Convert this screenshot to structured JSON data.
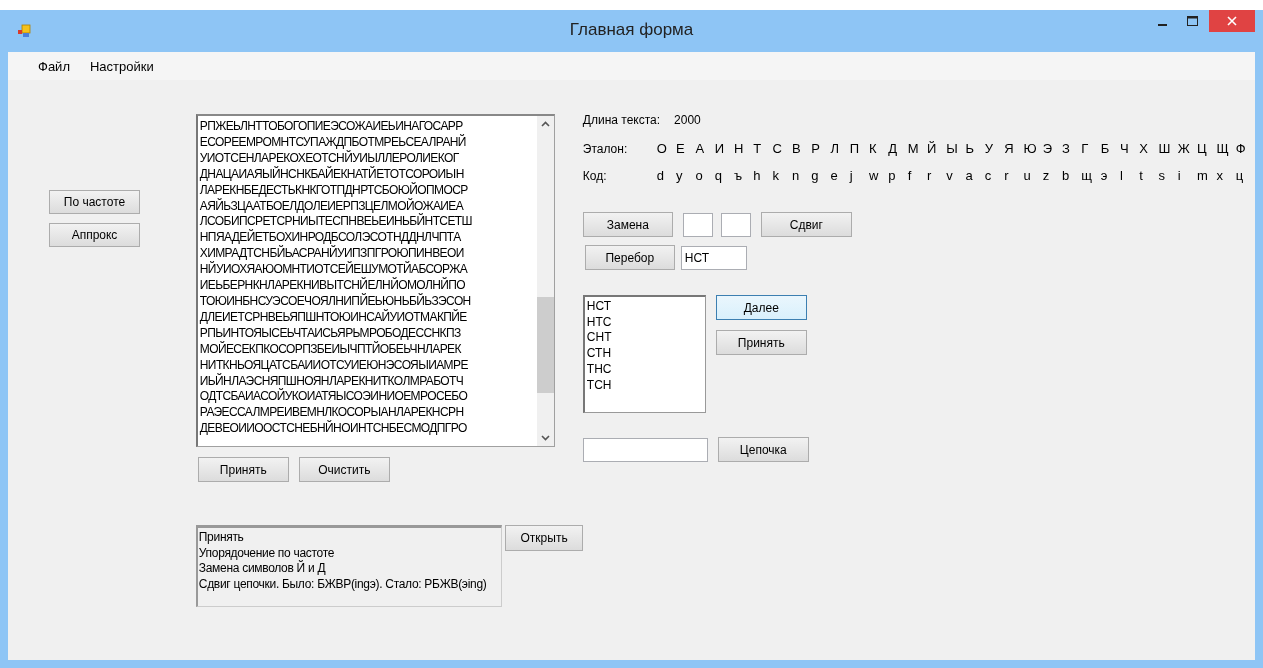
{
  "window": {
    "title": "Главная форма"
  },
  "menu": [
    {
      "label": "Файл"
    },
    {
      "label": "Настройки"
    }
  ],
  "left_buttons": [
    "По частоте",
    "Аппрокс"
  ],
  "text_lines": [
    "РПЖЕЬЛНТТОБОГОПИЕЭСОЖАИЕЬИНАГОСАРР",
    "ЕСОРЕЕМРОМНТСУПАЖДПБОТМРЕЬСЕАЛРАНЙ",
    "УИОТСЕНЛАРЕКОХЕОТСНЙУИЫЛЛЕРОЛИЕКОГ",
    "ДНАЦАИАЯЫЙНСНКБАЙЕКНАТЙЕТОТСОРОИЫН",
    "ЛАРЕКНБЕДЕСТЬКНКГОТПДНРТСБОЮЙОПМОСР",
    "АЯЙЬЗЦААТБОЕЛДОЛЕИЕРПЗЦЕЛМОЙОЖАИЕА",
    "ЛСОБИПСРЕТСРНИЫТЕСПНВЕЬЕИНЬБЙНТСЕТШ",
    "НПЯАДЕЙЕТБОХИНРОДБСОЛЭСОТНДДНЛЧПТА",
    "ХИМРАДТСНБЙЬАСРАНЙУИПЗПГРОЮПИНВЕОИ",
    "НЙУИОХЯАЮОМНТИОТСЕЙЕШУМОТЙАБСОРЖА",
    "ИЕЬБЕРНКНЛАРЕКНИВЫТСНЙЕЛНЙОМОЛНЙПО",
    "ТОЮИНБНСУЭСОЕЧОЯЛНИПЙЕЬЮНЬБЙЬЗЭСОН",
    "ДЛЕИЕТСРНВЕЬЯПШНТОЮИНСАЙУИОТМАКПЙЕ",
    "РПЬИНТОЯЫСЕЬЧТАИСЬЯРЬМРОБОДЕССНКПЗ",
    "МОЙЕСЕКПКОСОРПЗБЕИЫЧПТЙОБЕЬЧНЛАРЕК",
    "НИТКНЬОЯЦАТСБАИИОТСУИЕЮНЭСОЯЫИАМРЕ",
    "ИЬЙНЛАЭСНЯПШНОЯНЛАРЕКНИТКОЛМРАБОТЧ",
    "ОДТСБАИАСОЙУКОИАТЯЫСОЭИНИОЕМРОСЕБО",
    "РАЭЕССАЛМРЕИВЕМНЛКОСОРЫАНЛАРЕКНСРН",
    "ДЕВЕОИИООСТСНЕБНЙНОИНТСНБЕСМОДПГРО"
  ],
  "text_buttons": [
    "Принять",
    "Очистить"
  ],
  "length": {
    "label": "Длина текста:",
    "value": "2000"
  },
  "etalon": {
    "label": "Эталон:",
    "letters": [
      "О",
      "Е",
      "А",
      "И",
      "Н",
      "Т",
      "С",
      "В",
      "Р",
      "Л",
      "П",
      "К",
      "Д",
      "М",
      "Й",
      "Ы",
      "Ь",
      "У",
      "Я",
      "Ю",
      "Э",
      "З",
      "Г",
      "Б",
      "Ч",
      "Х",
      "Ш",
      "Ж",
      "Ц",
      "Щ",
      "Ф"
    ]
  },
  "code": {
    "label": "Код:",
    "letters": [
      "d",
      "y",
      "o",
      "q",
      "ъ",
      "h",
      "k",
      "n",
      "g",
      "e",
      "j",
      "w",
      "p",
      "f",
      "r",
      "v",
      "a",
      "c",
      "r",
      "u",
      "z",
      "b",
      "щ",
      "э",
      "l",
      "t",
      "s",
      "i",
      "m",
      "x",
      "ц"
    ]
  },
  "replace_button": "Замена",
  "shift_button": "Сдвиг",
  "search_button": "Перебор",
  "search_value": "НСТ",
  "variants": [
    {
      "label": "НСТ",
      "selected": false
    },
    {
      "label": "НТС",
      "selected": false
    },
    {
      "label": "СНТ",
      "selected": false
    },
    {
      "label": "СТН",
      "selected": false
    },
    {
      "label": "ТНС",
      "selected": false
    },
    {
      "label": "ТСН",
      "selected": false
    }
  ],
  "next_button": "Далее",
  "accept_button": "Принять",
  "chain_button": "Цепочка",
  "log": [
    "Принять",
    "Упорядочение по частоте",
    "Замена символов Й и Д",
    "Сдвиг цепочки. Было: БЖВР(ingэ). Стало: РБЖВ(эing)"
  ],
  "open_button": "Открыть"
}
